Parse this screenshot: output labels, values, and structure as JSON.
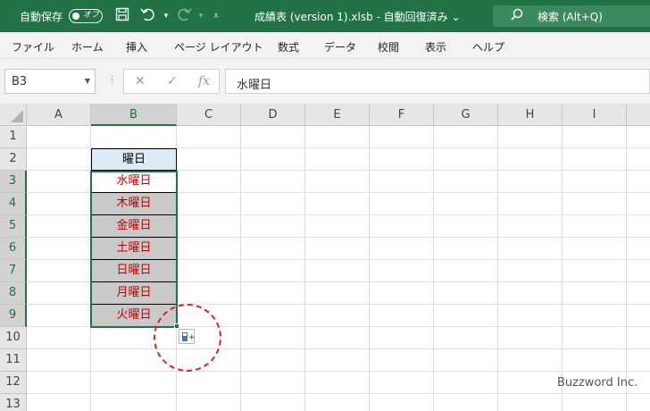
{
  "titlebar": {
    "autosave_label": "自動保存",
    "autosave_state": "オフ",
    "document_title": "成績表 (version 1).xlsb  -  自動回復済み  ⌄",
    "search_label": "検索 (Alt+Q)"
  },
  "menu": [
    "ファイル",
    "ホーム",
    "挿入",
    "ページ レイアウト",
    "数式",
    "データ",
    "校閲",
    "表示",
    "ヘルプ"
  ],
  "formula_bar": {
    "name_box": "B3",
    "fx_label": "fx",
    "content": "水曜日"
  },
  "columns": [
    "A",
    "B",
    "C",
    "D",
    "E",
    "F",
    "G",
    "H",
    "I"
  ],
  "rows": [
    "1",
    "2",
    "3",
    "4",
    "5",
    "6",
    "7",
    "8",
    "9",
    "10",
    "11",
    "12",
    "13"
  ],
  "table": {
    "header": "曜日",
    "days": [
      "水曜日",
      "木曜日",
      "金曜日",
      "土曜日",
      "日曜日",
      "月曜日",
      "火曜日"
    ]
  },
  "watermark": "Buzzword Inc.",
  "colors": {
    "title_bar": "#217346",
    "selection": "#217346",
    "header_fill": "#ddebf7",
    "day_fill": "#c9c9c9",
    "day_text": "#c00000",
    "highlight_circle": "#dd2222"
  }
}
